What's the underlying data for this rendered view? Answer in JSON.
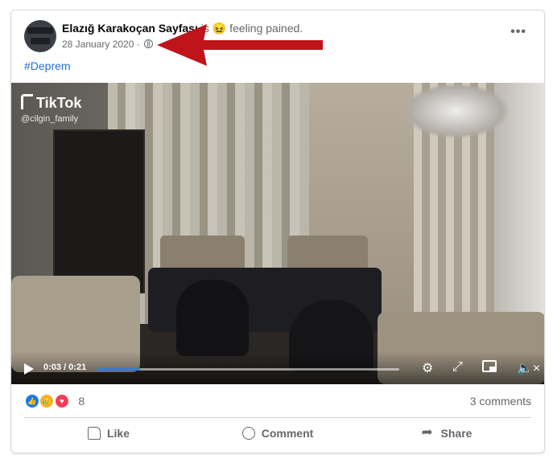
{
  "post": {
    "author": "Elazığ Karakoçan Sayfası",
    "status_prefix": "is",
    "feeling_emoji": "😖",
    "feeling": "feeling pained.",
    "date": "28 January 2020",
    "separator": "·",
    "privacy_icon": "globe-icon",
    "more_label": "•••",
    "hashtag": "#Deprem"
  },
  "video": {
    "watermark_brand": "TikTok",
    "watermark_user": "@cilgin_family",
    "time_display": "0:03 / 0:21",
    "progress_fraction": 0.143,
    "icons": [
      "play-icon",
      "gear-icon",
      "expand-icon",
      "pip-icon",
      "mute-icon"
    ],
    "gear_glyph": "⚙",
    "expand_glyph": "⤢",
    "mute_glyph": "🔈×"
  },
  "engagement": {
    "reaction_icons": [
      "like-reaction-icon",
      "sad-reaction-icon",
      "love-reaction-icon"
    ],
    "reaction_count": "8",
    "comments_count": "3 comments"
  },
  "actions": {
    "like": "Like",
    "comment": "Comment",
    "share": "Share"
  },
  "annotation": {
    "arrow_color": "#c0141b"
  },
  "colors": {
    "link": "#216fdb",
    "accent": "#1877f2",
    "muted": "#65676b"
  }
}
